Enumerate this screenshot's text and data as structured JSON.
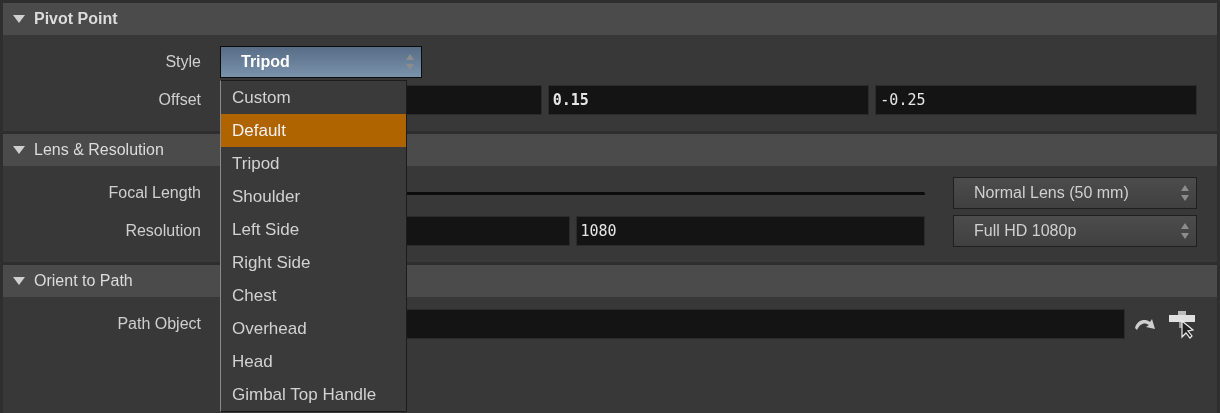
{
  "sections": [
    {
      "title": "Pivot Point",
      "expanded": true,
      "bold": true,
      "rows": [
        {
          "kind": "combo",
          "label": "Style",
          "value": "Tripod"
        },
        {
          "kind": "fields",
          "label": "Offset",
          "fields": [
            {
              "kind": "number"
            },
            {
              "kind": "number",
              "value": "0.15",
              "bold": true
            },
            {
              "kind": "number",
              "value": "-0.25",
              "bold": false
            }
          ]
        }
      ]
    },
    {
      "title": "Lens & Resolution",
      "expanded": true,
      "bold": false,
      "rows": [
        {
          "kind": "slider",
          "label": "Focal Length",
          "preset": "Normal Lens (50 mm)"
        },
        {
          "kind": "fields",
          "label": "Resolution",
          "fields": [
            {
              "kind": "number"
            },
            {
              "kind": "number",
              "value": "1080",
              "bold": false
            }
          ],
          "preset": "Full HD 1080p"
        }
      ]
    },
    {
      "title": "Orient to Path",
      "expanded": true,
      "bold": false,
      "rows": [
        {
          "kind": "path",
          "label": "Path Object"
        }
      ]
    }
  ],
  "style_menu": {
    "items": [
      {
        "label": "Custom",
        "selected": false
      },
      {
        "label": "Default",
        "selected": true
      },
      {
        "label": "Tripod",
        "selected": false
      },
      {
        "label": "Shoulder",
        "selected": false
      },
      {
        "label": "Left Side",
        "selected": false
      },
      {
        "label": "Right Side",
        "selected": false
      },
      {
        "label": "Chest",
        "selected": false
      },
      {
        "label": "Overhead",
        "selected": false
      },
      {
        "label": "Head",
        "selected": false
      },
      {
        "label": "Gimbal Top Handle",
        "selected": false
      }
    ]
  }
}
